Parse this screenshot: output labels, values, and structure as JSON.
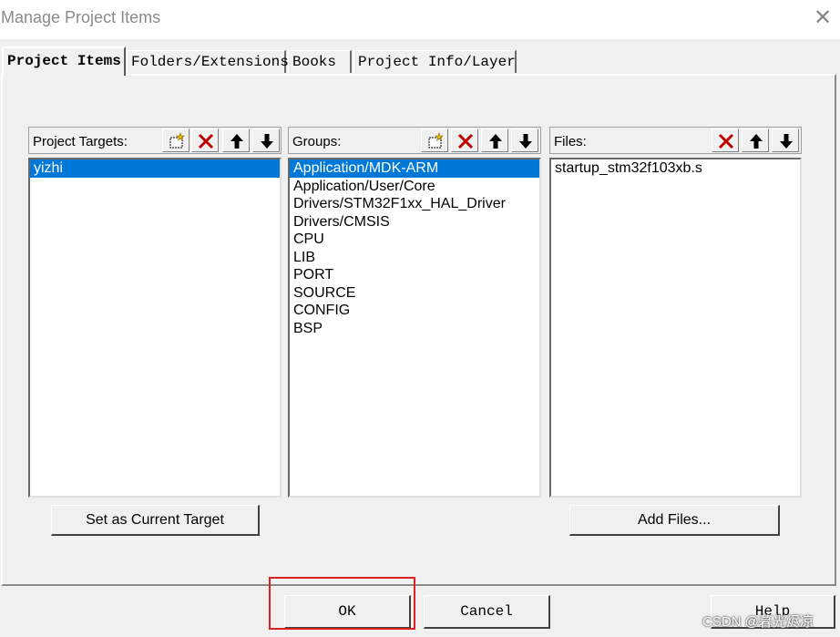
{
  "window": {
    "title": "Manage Project Items",
    "close_icon": "close-icon"
  },
  "tabs": [
    {
      "label": "Project Items",
      "active": true
    },
    {
      "label": "Folders/Extensions",
      "active": false
    },
    {
      "label": "Books",
      "active": false
    },
    {
      "label": "Project Info/Layer",
      "active": false
    }
  ],
  "targets": {
    "label": "Project Targets:",
    "items": [
      "yizhi"
    ],
    "selected": 0,
    "toolbar": [
      "new-icon",
      "delete-icon",
      "move-up-icon",
      "move-down-icon"
    ]
  },
  "groups": {
    "label": "Groups:",
    "items": [
      "Application/MDK-ARM",
      "Application/User/Core",
      "Drivers/STM32F1xx_HAL_Driver",
      "Drivers/CMSIS",
      "CPU",
      "LIB",
      "PORT",
      "SOURCE",
      "CONFIG",
      "BSP"
    ],
    "selected": 0,
    "toolbar": [
      "new-icon",
      "delete-icon",
      "move-up-icon",
      "move-down-icon"
    ]
  },
  "files": {
    "label": "Files:",
    "items": [
      "startup_stm32f103xb.s"
    ],
    "toolbar": [
      "delete-icon",
      "move-up-icon",
      "move-down-icon"
    ]
  },
  "buttons": {
    "set_target": "Set as Current Target",
    "add_files": "Add Files...",
    "ok": "OK",
    "cancel": "Cancel",
    "help": "Help"
  },
  "watermark": "CSDN @暮光烬凉",
  "colors": {
    "selection": "#0078d7",
    "delete_icon": "#c00000",
    "highlight_box": "#e02020",
    "dialog_bg": "#f0f0f0"
  }
}
